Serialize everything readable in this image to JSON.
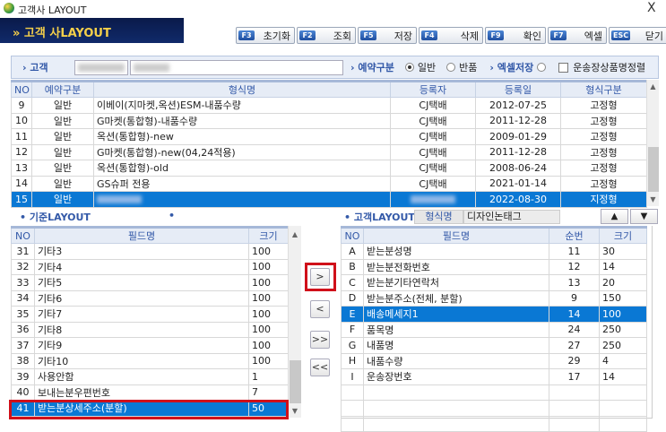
{
  "window": {
    "title": "고객사 LAYOUT",
    "close": "X"
  },
  "banner": {
    "title": "» 고객 사LAYOUT"
  },
  "toolbar": [
    {
      "key": "F3",
      "label": "초기화"
    },
    {
      "key": "F2",
      "label": "조회"
    },
    {
      "key": "F5",
      "label": "저장"
    },
    {
      "key": "F4",
      "label": "삭제"
    },
    {
      "key": "F9",
      "label": "확인"
    },
    {
      "key": "F7",
      "label": "엑셀"
    },
    {
      "key": "ESC",
      "label": "닫기"
    }
  ],
  "search": {
    "customer_label": "› 고객",
    "reservation_label": "› 예약구분",
    "opt_normal": "일반",
    "opt_return": "반품",
    "excel_label": "› 엑셀저장",
    "sort_label": "운송장상품명정렬",
    "selected": "일반"
  },
  "top_grid": {
    "headers": [
      "NO",
      "예약구분",
      "형식명",
      "등록자",
      "등록일",
      "형식구분"
    ],
    "rows": [
      [
        "9",
        "일반",
        "이베이(지마켓,옥션)ESM-내품수량",
        "CJ택배",
        "2012-07-25",
        "고정형"
      ],
      [
        "10",
        "일반",
        "G마켓(통합형)-내품수량",
        "CJ택배",
        "2011-12-28",
        "고정형"
      ],
      [
        "11",
        "일반",
        "옥션(통합형)-new",
        "CJ택배",
        "2009-01-29",
        "고정형"
      ],
      [
        "12",
        "일반",
        "G마켓(통합형)-new(04,24적용)",
        "CJ택배",
        "2011-12-28",
        "고정형"
      ],
      [
        "13",
        "일반",
        "옥션(통합형)-old",
        "CJ택배",
        "2008-06-24",
        "고정형"
      ],
      [
        "14",
        "일반",
        "GS슈퍼 전용",
        "CJ택배",
        "2021-01-14",
        "고정형"
      ],
      [
        "15",
        "일반",
        "",
        "",
        "2022-08-30",
        "지정형"
      ]
    ],
    "selected_index": 6
  },
  "base_layout": {
    "label": "• 기준LAYOUT",
    "dot": "•",
    "headers": [
      "NO",
      "필드명",
      "크기"
    ],
    "rows": [
      [
        "31",
        "기타3",
        "100"
      ],
      [
        "32",
        "기타4",
        "100"
      ],
      [
        "33",
        "기타5",
        "100"
      ],
      [
        "34",
        "기타6",
        "100"
      ],
      [
        "35",
        "기타7",
        "100"
      ],
      [
        "36",
        "기타8",
        "100"
      ],
      [
        "37",
        "기타9",
        "100"
      ],
      [
        "38",
        "기타10",
        "100"
      ],
      [
        "39",
        "사용안함",
        "1"
      ],
      [
        "40",
        "보내는분우편번호",
        "7"
      ],
      [
        "41",
        "받는분상세주소(분할)",
        "50"
      ]
    ],
    "selected_index": 10
  },
  "customer_layout": {
    "label": "• 고객LAYOUT",
    "format_label": "형식명",
    "format_value": "디자인논태그",
    "up": "▲",
    "down": "▼",
    "headers": [
      "NO",
      "필드명",
      "순번",
      "크기"
    ],
    "rows": [
      [
        "A",
        "받는분성명",
        "11",
        "30"
      ],
      [
        "B",
        "받는분전화번호",
        "12",
        "14"
      ],
      [
        "C",
        "받는분기타연락처",
        "13",
        "20"
      ],
      [
        "D",
        "받는분주소(전체, 분할)",
        "9",
        "150"
      ],
      [
        "E",
        "배송메세지1",
        "14",
        "100"
      ],
      [
        "F",
        "품목명",
        "24",
        "250"
      ],
      [
        "G",
        "내품명",
        "27",
        "250"
      ],
      [
        "H",
        "내품수량",
        "29",
        "4"
      ],
      [
        "I",
        "운송장번호",
        "17",
        "14"
      ]
    ],
    "selected_index": 4
  },
  "move_buttons": {
    "add": ">",
    "remove": "<",
    "add_all": ">>",
    "remove_all": "<<"
  },
  "colors": {
    "selection": "#0a78d4",
    "header_text": "#3359a8",
    "highlight_border": "#d0101a",
    "banner_bg": "#0a1a4a",
    "banner_text": "#f5d04a"
  }
}
